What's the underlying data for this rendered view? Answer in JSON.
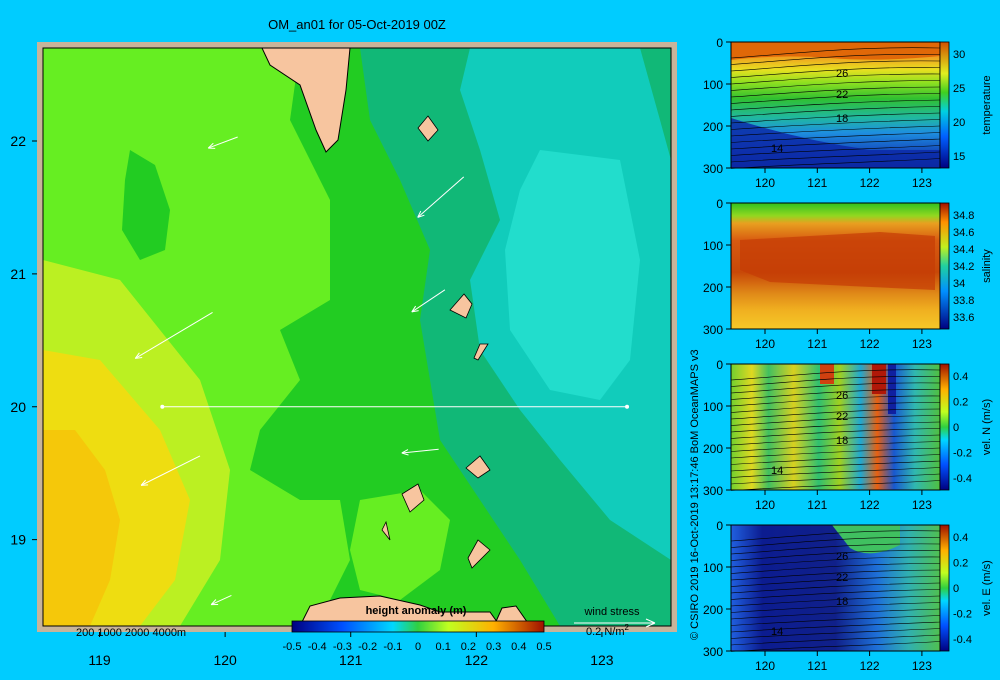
{
  "figure": {
    "title": "OM_an01 for 05-Oct-2019 00Z",
    "credit": "© CSIRO 2019  16-Oct-2019 13:17:46 BoM OceanMAPS v3",
    "depth_legend": "200  1000  2000  4000m",
    "wind_label": "wind stress",
    "wind_scale": "0.2 N/m",
    "wind_scale_sup": "2"
  },
  "colors": {
    "background": "#00ccff",
    "land": "#f7c59f",
    "frame": "#c8b49a"
  },
  "chart_data": [
    {
      "type": "heatmap",
      "name": "map",
      "colorbar_title": "height anomaly (m)",
      "colorbar_ticks": [
        "-0.5",
        "-0.4",
        "-0.3",
        "-0.2",
        "-0.1",
        "0",
        "0.1",
        "0.2",
        "0.3",
        "0.4",
        "0.5"
      ],
      "xlim": [
        118.55,
        123.55
      ],
      "ylim": [
        18.35,
        22.7
      ],
      "xticks": [
        119,
        120,
        121,
        122,
        123
      ],
      "yticks": [
        19,
        20,
        21,
        22
      ],
      "section_line": {
        "lat": 20,
        "lon_start": 119.5,
        "lon_end": 123.2
      },
      "wind_stress_vectors": [
        {
          "lon": 120.1,
          "lat": 22.03,
          "u": -0.16,
          "v": -0.06
        },
        {
          "lon": 121.9,
          "lat": 21.73,
          "u": -0.25,
          "v": -0.22
        },
        {
          "lon": 119.9,
          "lat": 20.71,
          "u": -0.42,
          "v": -0.25
        },
        {
          "lon": 121.75,
          "lat": 20.88,
          "u": -0.18,
          "v": -0.12
        },
        {
          "lon": 119.8,
          "lat": 19.63,
          "u": -0.32,
          "v": -0.16
        },
        {
          "lon": 121.7,
          "lat": 19.68,
          "u": -0.2,
          "v": -0.02
        },
        {
          "lon": 120.05,
          "lat": 18.58,
          "u": -0.11,
          "v": -0.05
        }
      ]
    },
    {
      "type": "heatmap",
      "name": "temperature",
      "colorbar_label": "temperature",
      "colorbar_ticks": [
        "30",
        "25",
        "20",
        "15"
      ],
      "xticks": [
        "120",
        "121",
        "122",
        "123"
      ],
      "yticks": [
        "0",
        "100",
        "200",
        "300"
      ],
      "contour_labels": [
        "26",
        "22",
        "18",
        "14"
      ]
    },
    {
      "type": "heatmap",
      "name": "salinity",
      "colorbar_label": "salinity",
      "colorbar_ticks": [
        "34.8",
        "34.6",
        "34.4",
        "34.2",
        "34",
        "33.8",
        "33.6"
      ],
      "xticks": [
        "120",
        "121",
        "122",
        "123"
      ],
      "yticks": [
        "0",
        "100",
        "200",
        "300"
      ]
    },
    {
      "type": "heatmap",
      "name": "vel-n",
      "colorbar_label": "vel. N (m/s)",
      "colorbar_ticks": [
        "0.4",
        "0.2",
        "0",
        "-0.2",
        "-0.4"
      ],
      "xticks": [
        "120",
        "121",
        "122",
        "123"
      ],
      "yticks": [
        "0",
        "100",
        "200",
        "300"
      ],
      "contour_labels": [
        "26",
        "22",
        "18",
        "14"
      ]
    },
    {
      "type": "heatmap",
      "name": "vel-e",
      "colorbar_label": "vel. E (m/s)",
      "colorbar_ticks": [
        "0.4",
        "0.2",
        "0",
        "-0.2",
        "-0.4"
      ],
      "xticks": [
        "120",
        "121",
        "122",
        "123"
      ],
      "yticks": [
        "0",
        "100",
        "200",
        "300"
      ],
      "contour_labels": [
        "26",
        "22",
        "18",
        "14"
      ]
    }
  ]
}
